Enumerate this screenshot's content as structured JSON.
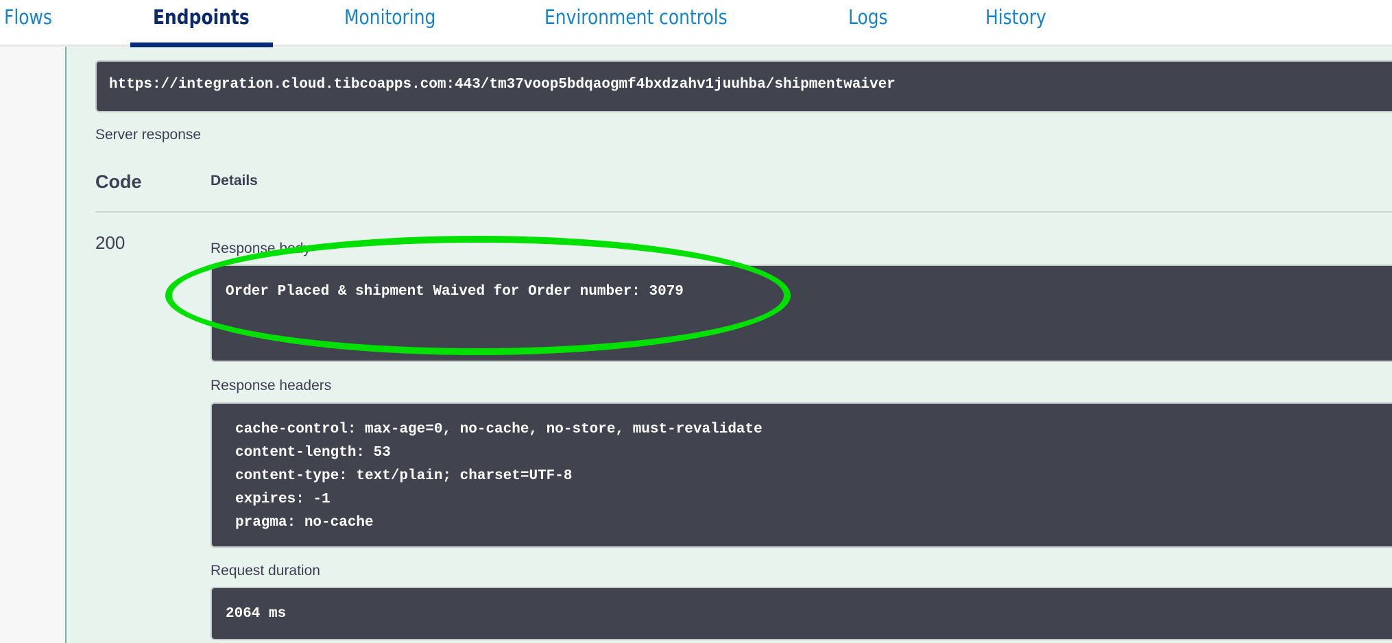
{
  "nav": {
    "tabs": [
      {
        "label": "Flows"
      },
      {
        "label": "Endpoints"
      },
      {
        "label": "Monitoring"
      },
      {
        "label": "Environment controls"
      },
      {
        "label": "Logs"
      },
      {
        "label": "History"
      }
    ],
    "active": "Endpoints"
  },
  "request_url": "https://integration.cloud.tibcoapps.com:443/tm37voop5bdqaogmf4bxdzahv1juuhba/shipmentwaiver",
  "server_response": {
    "title": "Server response",
    "col_code": "Code",
    "col_details": "Details",
    "code": "200",
    "body_label": "Response body",
    "body": "Order Placed & shipment Waived for Order number: 3079",
    "headers_label": "Response headers",
    "headers": [
      "cache-control: max-age=0, no-cache, no-store, must-revalidate",
      "content-length: 53",
      "content-type: text/plain; charset=UTF-8",
      "expires: -1",
      "pragma: no-cache"
    ],
    "duration_label": "Request duration",
    "duration": "2064 ms"
  },
  "colors": {
    "highlight": "#00e000",
    "accent": "#1683c8",
    "active_tab": "#0b2a6b"
  }
}
